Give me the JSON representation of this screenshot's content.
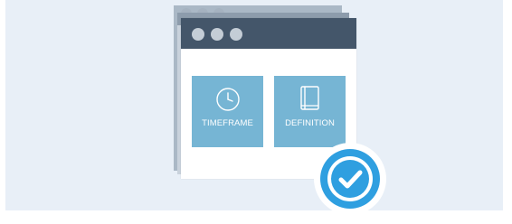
{
  "window": {
    "controls": [
      "window-dot",
      "window-dot",
      "window-dot"
    ]
  },
  "tiles": [
    {
      "label": "TIMEFRAME",
      "icon": "clock-icon"
    },
    {
      "label": "DEFINITION",
      "icon": "book-icon"
    }
  ],
  "badge": {
    "icon": "checkmark-icon",
    "color": "#2f9fe0"
  },
  "colors": {
    "background": "#e8eff7",
    "titlebar": "#44566a",
    "tile": "#76b5d4"
  }
}
